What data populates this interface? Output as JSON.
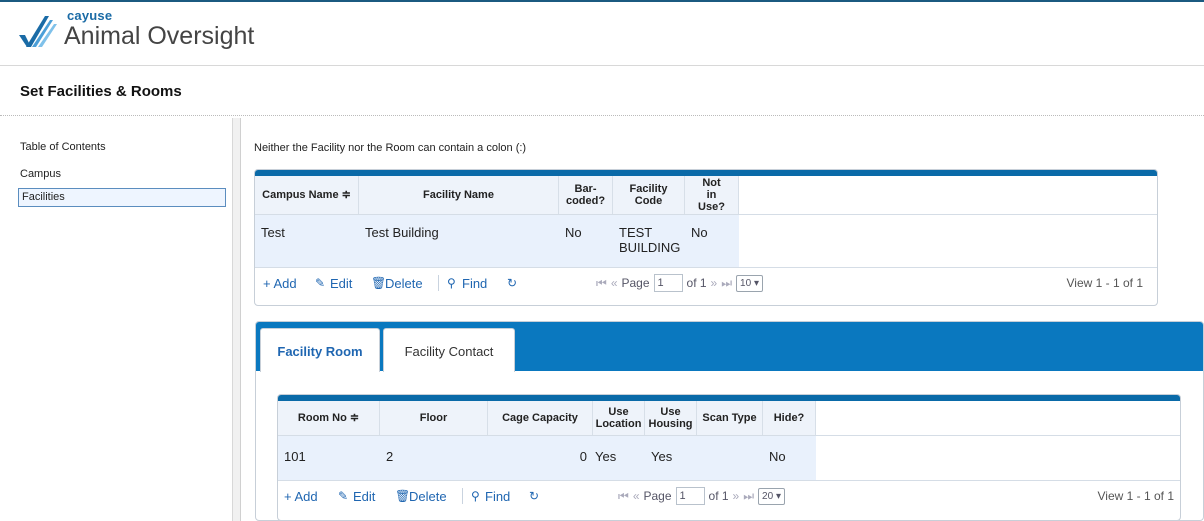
{
  "brand": {
    "small": "cayuse",
    "big": "Animal Oversight"
  },
  "page_title": "Set Facilities & Rooms",
  "sidebar": {
    "toc": "Table of Contents",
    "items": [
      {
        "label": "Campus"
      },
      {
        "label": "Facilities"
      }
    ]
  },
  "note": "Neither the Facility nor the Room can contain a colon (:)",
  "facilities_grid": {
    "columns": [
      {
        "label": "Campus Name ≑"
      },
      {
        "label": "Facility Name"
      },
      {
        "label": "Bar-coded?"
      },
      {
        "label": "Facility Code"
      },
      {
        "label": "Not in Use?"
      }
    ],
    "rows": [
      [
        "Test",
        "Test Building",
        "No",
        "TEST BUILDING",
        "No"
      ]
    ],
    "pager": {
      "add": "+ Add",
      "edit": "Edit",
      "delete": "Delete",
      "find": "Find",
      "page_label": "Page",
      "page": "1",
      "of": "of 1",
      "per_page": "10",
      "view": "View 1 - 1 of 1"
    }
  },
  "tabs": [
    {
      "label": "Facility Room"
    },
    {
      "label": "Facility Contact"
    }
  ],
  "rooms_grid": {
    "columns": [
      {
        "label": "Room No ≑"
      },
      {
        "label": "Floor"
      },
      {
        "label": "Cage Capacity"
      },
      {
        "label": "Use Location"
      },
      {
        "label": "Use Housing"
      },
      {
        "label": "Scan Type"
      },
      {
        "label": "Hide?"
      }
    ],
    "rows": [
      [
        "101",
        "2",
        "0",
        "Yes",
        "Yes",
        "",
        "No"
      ]
    ],
    "pager": {
      "add": "+ Add",
      "edit": "Edit",
      "delete": "Delete",
      "find": "Find",
      "page_label": "Page",
      "page": "1",
      "of": "of 1",
      "per_page": "20",
      "view": "View 1 - 1 of 1"
    }
  },
  "colors": {
    "accent": "#0a78bf",
    "link": "#1f66b1",
    "row_selected": "#e9f1fc"
  }
}
